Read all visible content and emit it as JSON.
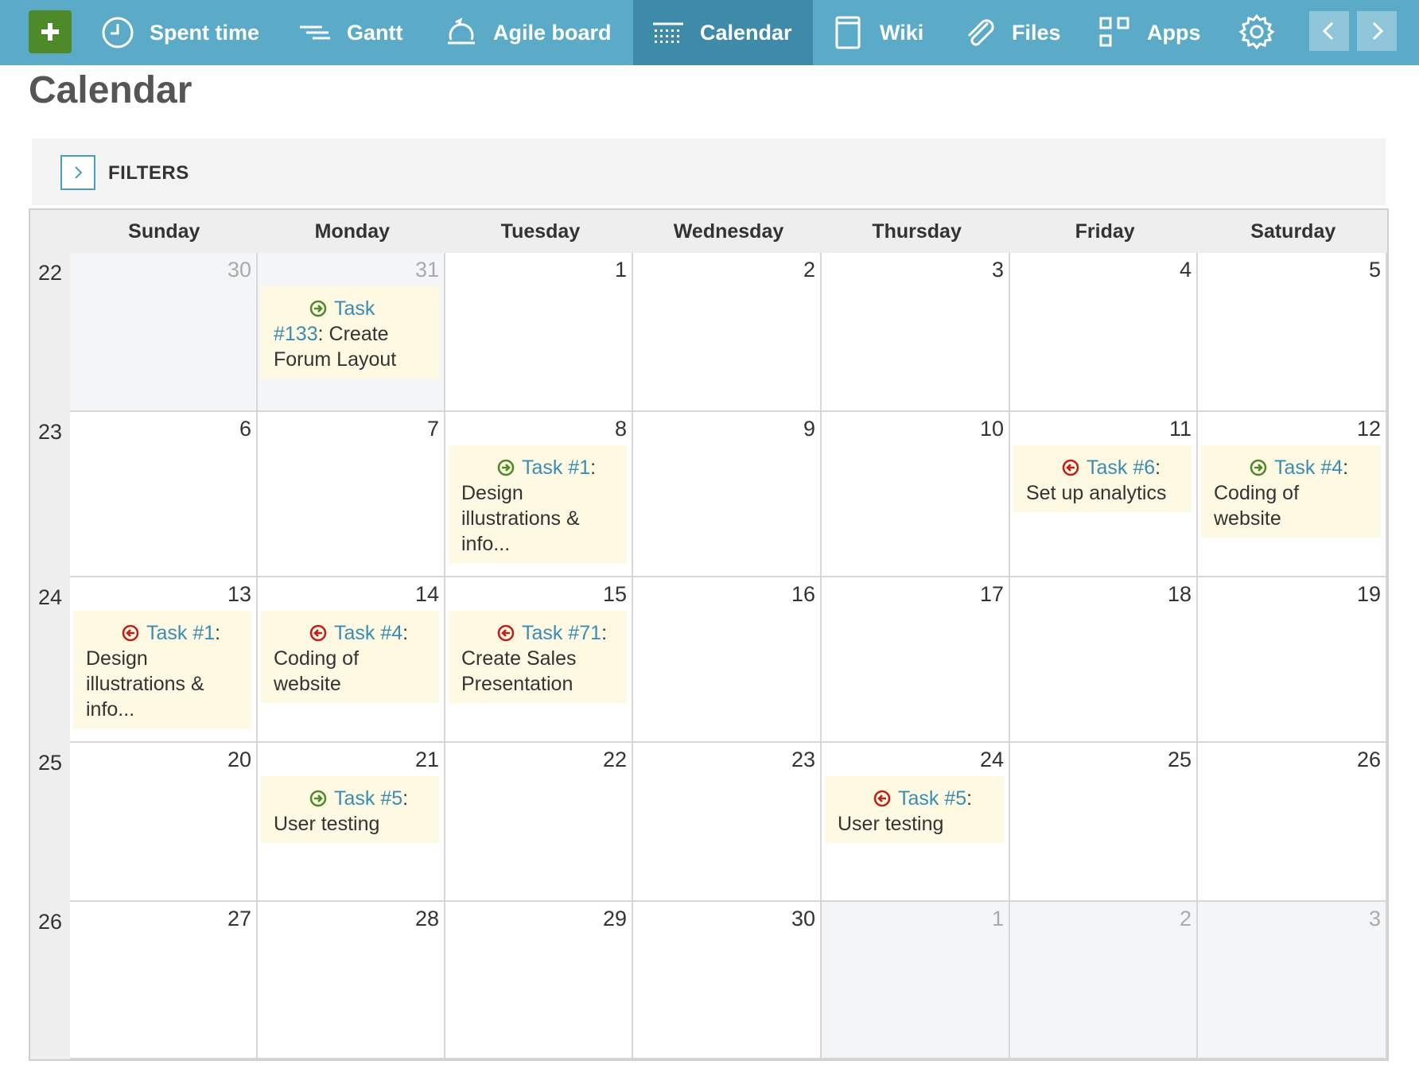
{
  "nav": {
    "items": [
      {
        "label": "Spent time",
        "icon": "clock-icon"
      },
      {
        "label": "Gantt",
        "icon": "gantt-icon"
      },
      {
        "label": "Agile board",
        "icon": "agile-board-icon"
      },
      {
        "label": "Calendar",
        "icon": "calendar-icon",
        "active": true
      },
      {
        "label": "Wiki",
        "icon": "wiki-icon"
      },
      {
        "label": "Files",
        "icon": "paperclip-icon"
      },
      {
        "label": "Apps",
        "icon": "apps-grid-icon"
      }
    ],
    "brand_color": "#5aaac8",
    "active_color": "#3d8ba8",
    "add_button_color": "#4e8a2a"
  },
  "page": {
    "title": "Calendar"
  },
  "filters": {
    "label": "FILTERS"
  },
  "calendar": {
    "day_names": [
      "Sunday",
      "Monday",
      "Tuesday",
      "Wednesday",
      "Thursday",
      "Friday",
      "Saturday"
    ],
    "weeks": [
      {
        "number": "22",
        "days": [
          {
            "day": "30",
            "other_month": true,
            "events": []
          },
          {
            "day": "31",
            "other_month": true,
            "events": [
              {
                "status": "start",
                "link": "Task #133",
                "title": "Create Forum Layout"
              }
            ]
          },
          {
            "day": "1",
            "events": []
          },
          {
            "day": "2",
            "events": []
          },
          {
            "day": "3",
            "events": []
          },
          {
            "day": "4",
            "events": []
          },
          {
            "day": "5",
            "events": []
          }
        ]
      },
      {
        "number": "23",
        "days": [
          {
            "day": "6",
            "events": []
          },
          {
            "day": "7",
            "events": []
          },
          {
            "day": "8",
            "events": [
              {
                "status": "start",
                "link": "Task #1",
                "title": "Design illustrations & info..."
              }
            ]
          },
          {
            "day": "9",
            "events": []
          },
          {
            "day": "10",
            "events": []
          },
          {
            "day": "11",
            "events": [
              {
                "status": "end",
                "link": "Task #6",
                "title": "Set up analytics"
              }
            ]
          },
          {
            "day": "12",
            "events": [
              {
                "status": "start",
                "link": "Task #4",
                "title": "Coding of website"
              }
            ]
          }
        ]
      },
      {
        "number": "24",
        "days": [
          {
            "day": "13",
            "events": [
              {
                "status": "end",
                "link": "Task #1",
                "title": "Design illustrations & info..."
              }
            ]
          },
          {
            "day": "14",
            "events": [
              {
                "status": "end",
                "link": "Task #4",
                "title": "Coding of website"
              }
            ]
          },
          {
            "day": "15",
            "events": [
              {
                "status": "end",
                "link": "Task #71",
                "title": "Create Sales Presentation"
              }
            ]
          },
          {
            "day": "16",
            "events": []
          },
          {
            "day": "17",
            "events": []
          },
          {
            "day": "18",
            "events": []
          },
          {
            "day": "19",
            "events": []
          }
        ]
      },
      {
        "number": "25",
        "days": [
          {
            "day": "20",
            "events": []
          },
          {
            "day": "21",
            "events": [
              {
                "status": "start",
                "link": "Task #5",
                "title": "User testing"
              }
            ]
          },
          {
            "day": "22",
            "events": []
          },
          {
            "day": "23",
            "events": []
          },
          {
            "day": "24",
            "events": [
              {
                "status": "end",
                "link": "Task #5",
                "title": "User testing"
              }
            ]
          },
          {
            "day": "25",
            "events": []
          },
          {
            "day": "26",
            "events": []
          }
        ]
      },
      {
        "number": "26",
        "days": [
          {
            "day": "27",
            "events": []
          },
          {
            "day": "28",
            "events": []
          },
          {
            "day": "29",
            "events": []
          },
          {
            "day": "30",
            "events": []
          },
          {
            "day": "1",
            "other_month": true,
            "events": []
          },
          {
            "day": "2",
            "other_month": true,
            "events": []
          },
          {
            "day": "3",
            "other_month": true,
            "events": []
          }
        ]
      }
    ],
    "status_colors": {
      "start": "#4e8a2a",
      "end": "#c0201c"
    }
  }
}
